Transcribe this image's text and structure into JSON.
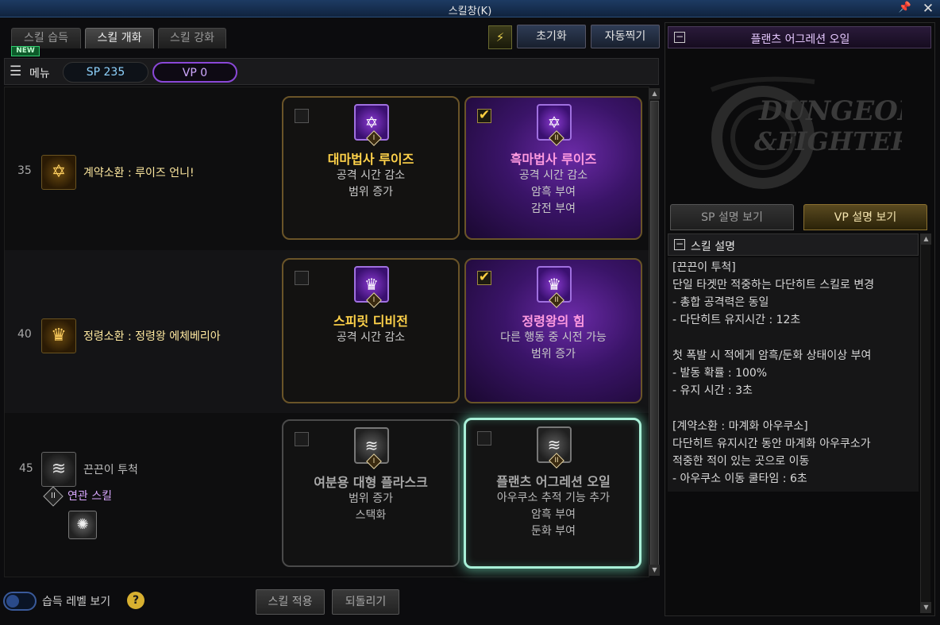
{
  "window": {
    "title": "스킬창(K)"
  },
  "tabs": [
    "스킬 습득",
    "스킬 개화",
    "스킬 강화"
  ],
  "new_badge": "NEW",
  "toolbar": {
    "reset": "초기화",
    "auto": "자동찍기"
  },
  "menu": {
    "label": "메뉴",
    "sp": "SP 235",
    "vp": "VP 0"
  },
  "rows": [
    {
      "level": "35",
      "name": "계약소환 : 루이즈 언니!",
      "cards": [
        {
          "checked": false,
          "rank": "I",
          "title": "대마법사 루이즈",
          "lines": [
            "공격 시간 감소",
            "범위 증가"
          ]
        },
        {
          "checked": true,
          "rank": "II",
          "title": "흑마법사 루이즈",
          "lines": [
            "공격 시간 감소",
            "암흑 부여",
            "감전 부여"
          ]
        }
      ]
    },
    {
      "level": "40",
      "name": "정령소환 : 정령왕 에체베리아",
      "cards": [
        {
          "checked": false,
          "rank": "I",
          "title": "스피릿 디비전",
          "lines": [
            "공격 시간 감소"
          ]
        },
        {
          "checked": true,
          "rank": "II",
          "title": "정령왕의 힘",
          "lines": [
            "다른 행동 중 시전 가능",
            "범위 증가"
          ]
        }
      ]
    },
    {
      "level": "45",
      "name": "끈끈이 투척",
      "related_rank": "II",
      "related_label": "연관 스킬",
      "cards": [
        {
          "checked": false,
          "rank": "I",
          "title": "여분용 대형 플라스크",
          "lines": [
            "범위 증가",
            "스택화"
          ]
        },
        {
          "checked": false,
          "rank": "II",
          "title": "플랜츠 어그레션 오일",
          "lines": [
            "아우쿠소 추적 기능 추가",
            "암흑 부여",
            "둔화 부여"
          ]
        }
      ]
    }
  ],
  "bottom": {
    "toggle_label": "습득 레벨 보기",
    "help": "?",
    "apply": "스킬 적용",
    "revert": "되돌리기"
  },
  "right": {
    "title": "플랜츠 어그레션 오일",
    "logo_line1": "DUNGEON",
    "logo_line2": "&FIGHTER",
    "tab_sp": "SP 설명 보기",
    "tab_vp": "VP 설명 보기",
    "desc_header": "스킬 설명",
    "desc_lines": [
      "[끈끈이 투척]",
      "단일 타겟만 적중하는 다단히트 스킬로 변경",
      "  - 총합 공격력은 동일",
      "  - 다단히트 유지시간 : 12초",
      "",
      "첫 폭발 시 적에게 암흑/둔화 상태이상 부여",
      "  - 발동 확률 : 100%",
      "  - 유지 시간 : 3초",
      "",
      "[계약소환 : 마계화 아우쿠소]",
      "다단히트 유지시간 동안 마계화 아우쿠소가",
      "적중한 적이 있는 곳으로 이동",
      "  - 아우쿠소 이동 쿨타임 : 6초"
    ]
  },
  "colors": {
    "accent_gold": "#ffd24a",
    "vp_purple": "#8a48d8",
    "glow": "#a8f0d8"
  }
}
